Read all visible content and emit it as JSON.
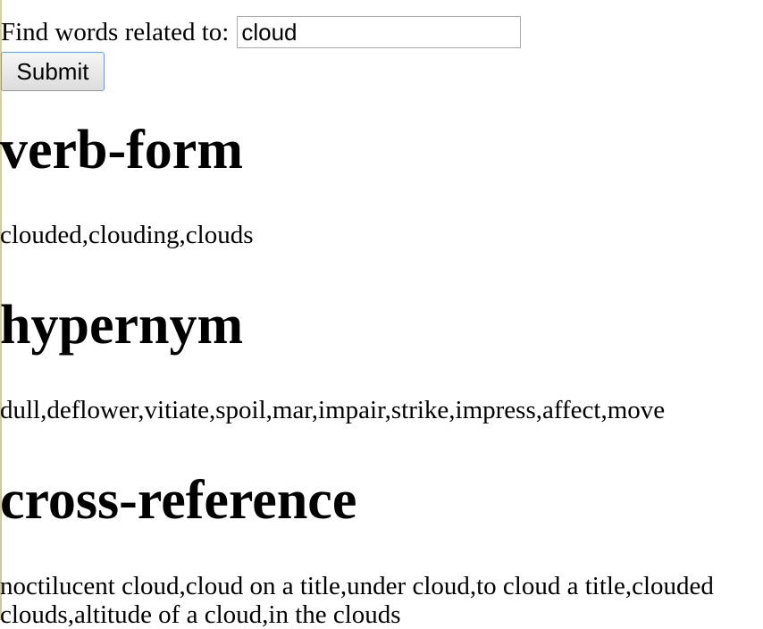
{
  "search": {
    "label": "Find words related to:",
    "value": "cloud",
    "submit_label": "Submit"
  },
  "sections": [
    {
      "heading": "verb-form",
      "words": "clouded,clouding,clouds"
    },
    {
      "heading": "hypernym",
      "words": "dull,deflower,vitiate,spoil,mar,impair,strike,impress,affect,move"
    },
    {
      "heading": "cross-reference",
      "words_line1": "noctilucent cloud,cloud on a title,under cloud,to cloud a title,clouded",
      "words_line2": "clouds,altitude of a cloud,in the clouds"
    }
  ]
}
